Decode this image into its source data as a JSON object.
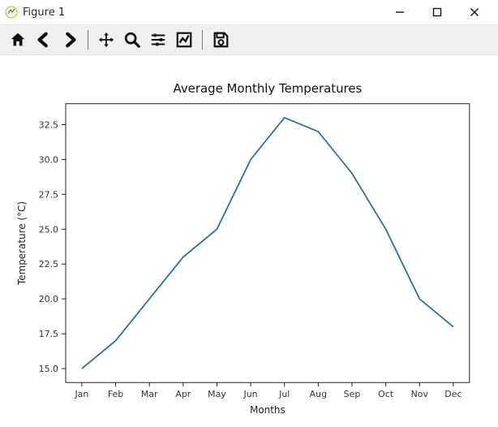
{
  "window": {
    "title": "Figure 1"
  },
  "toolbar": {
    "home": "Home",
    "back": "Back",
    "forward": "Forward",
    "pan": "Pan",
    "zoom": "Zoom",
    "subplots": "Configure subplots",
    "axes": "Edit axes",
    "save": "Save"
  },
  "chart_data": {
    "type": "line",
    "title": "Average Monthly Temperatures",
    "xlabel": "Months",
    "ylabel": "Temperature (°C)",
    "categories": [
      "Jan",
      "Feb",
      "Mar",
      "Apr",
      "May",
      "Jun",
      "Jul",
      "Aug",
      "Sep",
      "Oct",
      "Nov",
      "Dec"
    ],
    "values": [
      15.0,
      17.0,
      20.0,
      23.0,
      25.0,
      30.0,
      33.0,
      32.0,
      29.0,
      25.0,
      20.0,
      18.0
    ],
    "yticks": [
      15.0,
      17.5,
      20.0,
      22.5,
      25.0,
      27.5,
      30.0,
      32.5
    ],
    "ylim": [
      14.0,
      34.0
    ],
    "grid": false,
    "legend": false
  }
}
